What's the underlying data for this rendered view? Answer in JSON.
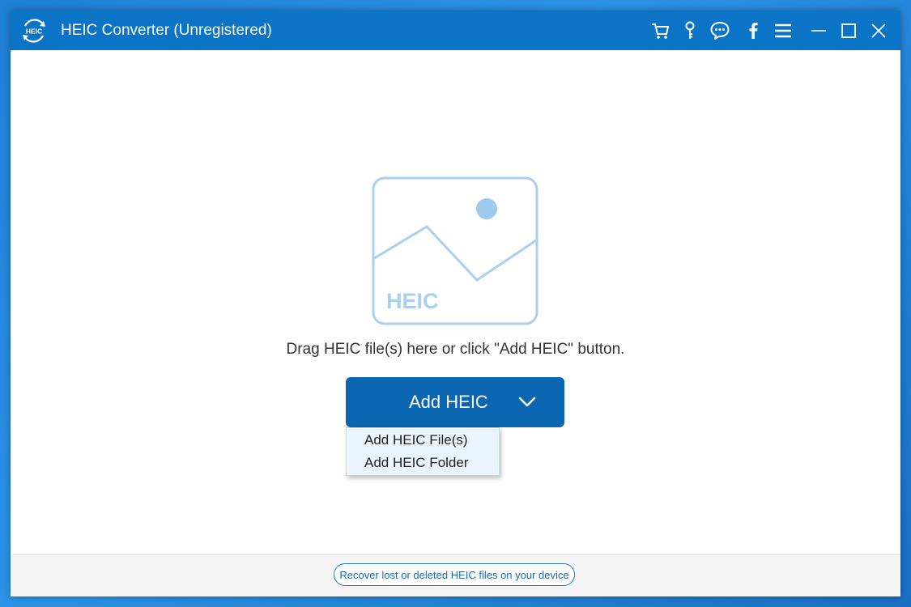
{
  "window": {
    "title": "HEIC Converter (Unregistered)",
    "logo_text": "HEIC"
  },
  "toolbar": {
    "icons": [
      "cart-icon",
      "key-icon",
      "chat-icon",
      "facebook-icon",
      "menu-icon",
      "minimize-icon",
      "maximize-icon",
      "close-icon"
    ]
  },
  "main": {
    "illustration_label": "HEIC",
    "drop_hint": "Drag HEIC file(s) here or click \"Add HEIC\" button.",
    "add_button_label": "Add HEIC",
    "dropdown_items": [
      {
        "label": "Add HEIC File(s)"
      },
      {
        "label": "Add HEIC Folder"
      }
    ]
  },
  "footer": {
    "recover_link": "Recover lost or deleted HEIC files on your device"
  },
  "colors": {
    "titlebar": "#0b74c6",
    "button": "#0a66b0",
    "illustration_stroke": "#a9d0ec",
    "illustration_fill": "#9fcbec",
    "dropdown_hover": "#eaf4fd",
    "desktop": "#1f7fd6"
  }
}
